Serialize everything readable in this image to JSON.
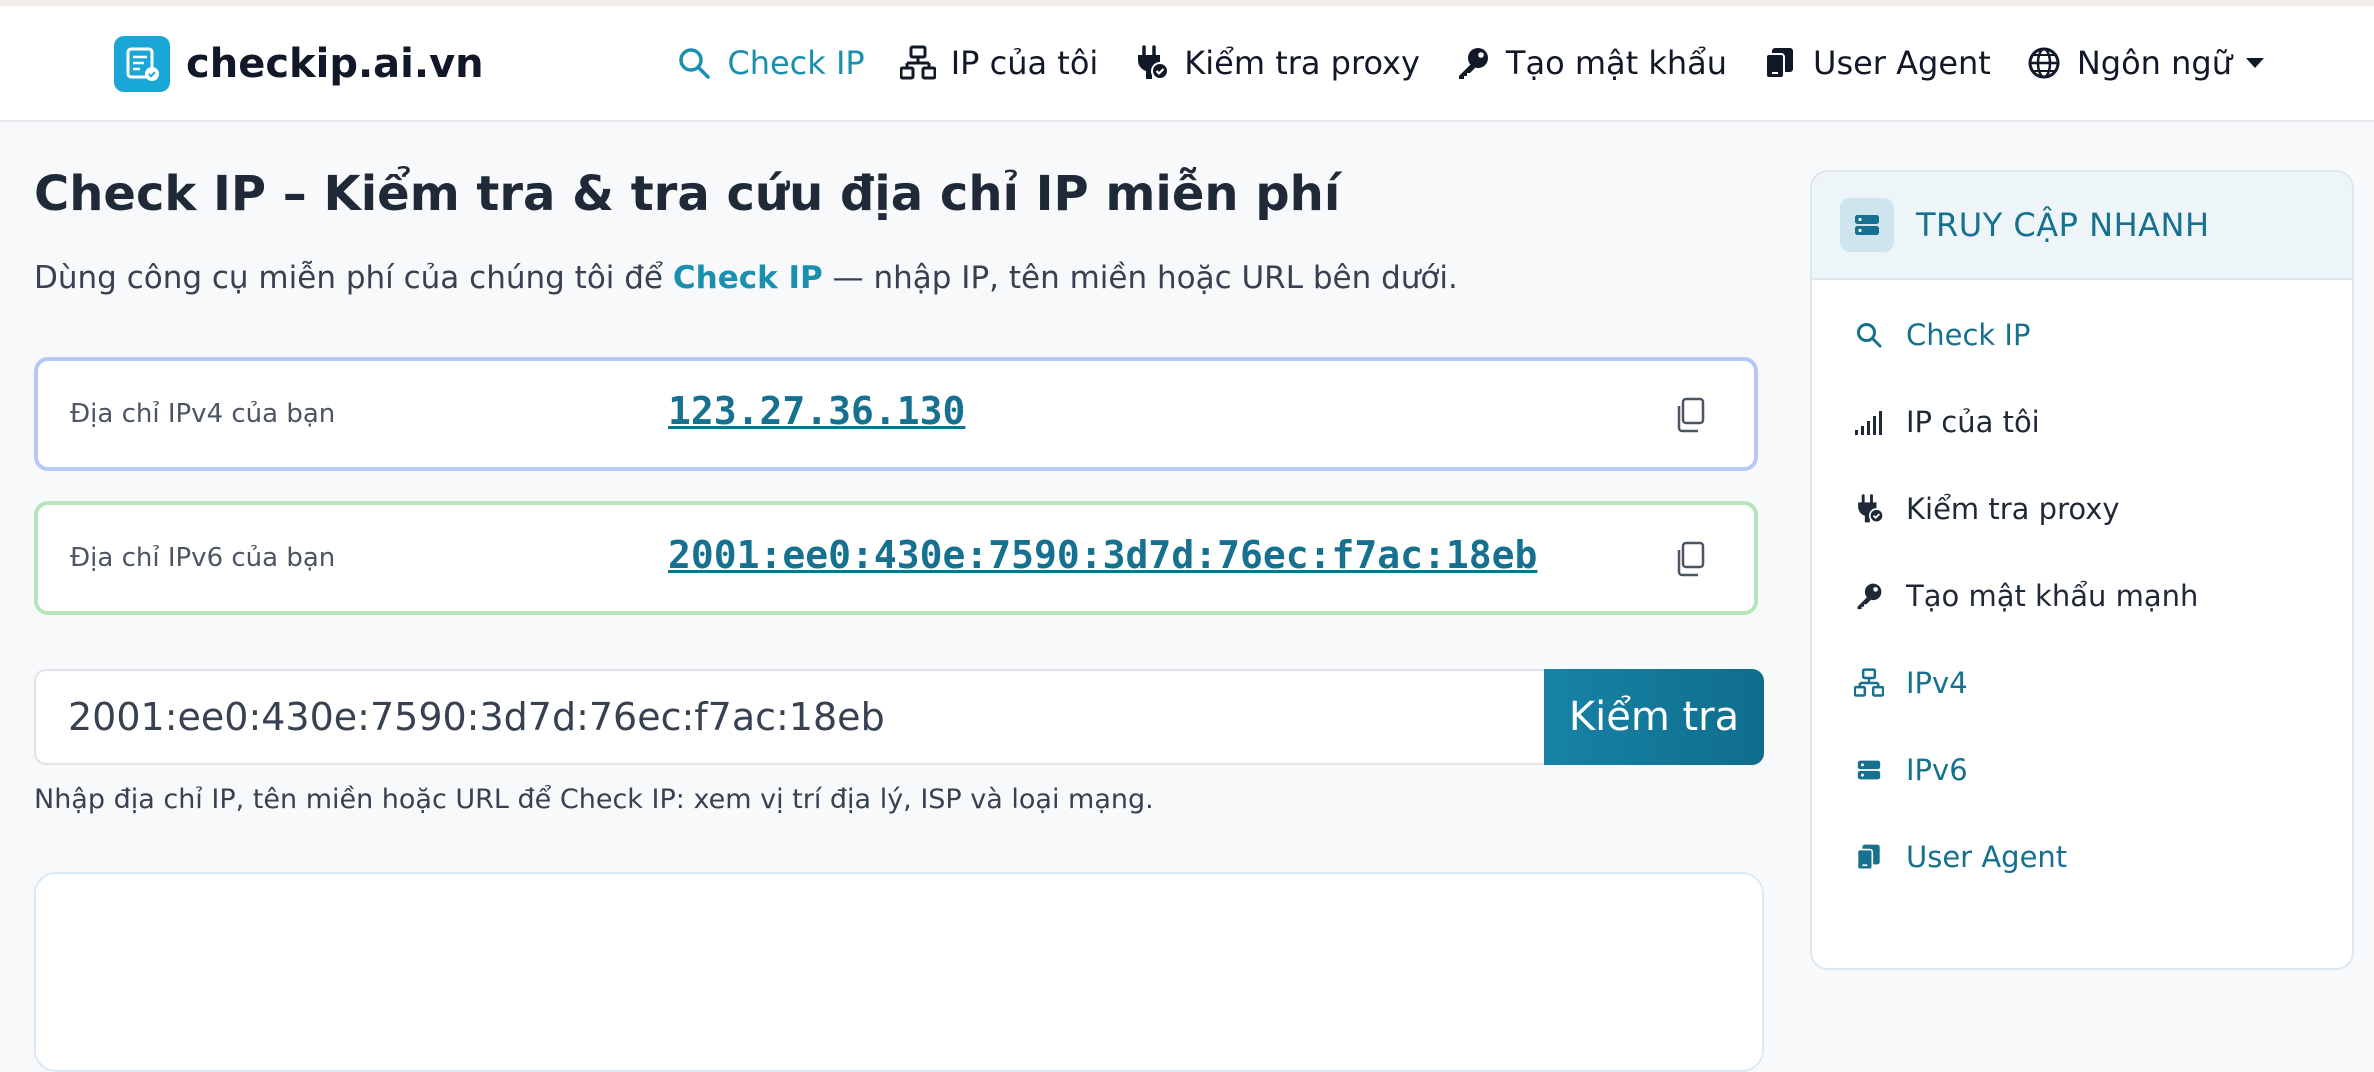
{
  "site": {
    "name": "checkip.ai.vn"
  },
  "nav": {
    "items": [
      {
        "label": "Check IP",
        "icon": "search-icon",
        "active": true
      },
      {
        "label": "IP của tôi",
        "icon": "network-icon"
      },
      {
        "label": "Kiểm tra proxy",
        "icon": "plug-check-icon"
      },
      {
        "label": "Tạo mật khẩu",
        "icon": "key-icon"
      },
      {
        "label": "User Agent",
        "icon": "devices-icon"
      },
      {
        "label": "Ngôn ngữ",
        "icon": "globe-icon",
        "dropdown": true
      }
    ]
  },
  "main": {
    "title": "Check IP – Kiểm tra & tra cứu địa chỉ IP miễn phí",
    "subtitle_before": "Dùng công cụ miễn phí của chúng tôi để ",
    "subtitle_highlight": "Check IP",
    "subtitle_after": " — nhập IP, tên miền hoặc URL bên dưới.",
    "ipv4": {
      "label": "Địa chỉ IPv4 của bạn",
      "value": "123.27.36.130"
    },
    "ipv6": {
      "label": "Địa chỉ IPv6 của bạn",
      "value": "2001:ee0:430e:7590:3d7d:76ec:f7ac:18eb"
    },
    "search": {
      "value": "2001:ee0:430e:7590:3d7d:76ec:f7ac:18eb",
      "button_label": "Kiểm tra"
    },
    "hint": "Nhập địa chỉ IP, tên miền hoặc URL để Check IP: xem vị trí địa lý, ISP và loại mạng."
  },
  "sidebar": {
    "title": "TRUY CẬP NHANH",
    "items": [
      {
        "label": "Check IP",
        "icon": "search-icon"
      },
      {
        "label": "IP của tôi",
        "icon": "signal-icon"
      },
      {
        "label": "Kiểm tra proxy",
        "icon": "plug-check-icon"
      },
      {
        "label": "Tạo mật khẩu mạnh",
        "icon": "key-icon"
      },
      {
        "label": "IPv4",
        "icon": "network-icon"
      },
      {
        "label": "IPv6",
        "icon": "server-icon"
      },
      {
        "label": "User Agent",
        "icon": "devices-icon"
      }
    ]
  },
  "colors": {
    "accent": "#1a8fb0",
    "accent_dark": "#16708f",
    "brand": "#1aa7d8",
    "ipv4_border": "#b6c9f4",
    "ipv6_border": "#b5e6b9"
  }
}
